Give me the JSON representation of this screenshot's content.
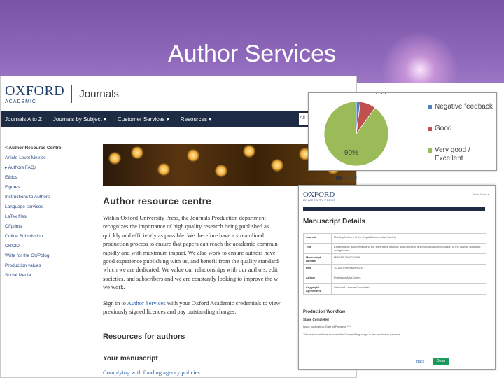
{
  "slide": {
    "title": "Author Services"
  },
  "oup": {
    "logo": {
      "oxford": "OXFORD",
      "academic": "ACADEMIC",
      "journals": "Journals"
    },
    "nav": [
      "Journals A to Z",
      "Journals by Subject ▾",
      "Customer Services ▾",
      "Resources ▾"
    ],
    "search_placeholder": "All",
    "sidebar": {
      "back": "< Author Resource Centre",
      "items": [
        "Article-Level Metrics",
        "Authors FAQs",
        "Ethics",
        "Figures",
        "Instructions to Authors",
        "Language services",
        "LaTex files",
        "Offprints",
        "Online Submission",
        "ORCID",
        "Write for the OUPblog",
        "Production values",
        "Social Media"
      ]
    },
    "page_title": "Author resource centre",
    "para_lines": [
      "Within Oxford University Press, the Journals Production department",
      "recognizes the importance of high quality research being published as",
      "quickly and efficiently as possible. We therefore have a streamlined",
      "production process to ensure that papers can reach the academic commun",
      "rapidly and with maximum impact. We also work to ensure authors have",
      "good experience publishing with us, and benefit from the quality standard",
      "which we are dedicated. We value our relationships with our authors, edit",
      "societies, and subscribers and we are constantly looking to improve the w",
      "we work."
    ],
    "signin": {
      "pre": "Sign in to ",
      "link": "Author Services",
      "post": " with your Oxford Academic credentials to view",
      "line2": "previously signed licences and pay outstanding charges."
    },
    "resources_heading": "Resources for authors",
    "manuscript_heading": "Your manuscript",
    "funding_link": "Complying with funding agency policies"
  },
  "chart_data": {
    "type": "pie",
    "categories": [
      "Negative feedback",
      "Good",
      "Very good / Excellent"
    ],
    "values": [
      2,
      8,
      90
    ],
    "data_labels": [
      "2%",
      "8%",
      "90%"
    ],
    "colors": [
      "#4f81bd",
      "#c0504d",
      "#9bbb59"
    ],
    "legend_position": "right"
  },
  "legend": [
    "Negative feedback",
    "Good",
    "Very good /\nExcellent"
  ],
  "youtube": "YouTu",
  "manuscript": {
    "logo": {
      "oxford": "OXFORD",
      "press": "UNIVERSITY PRESS"
    },
    "account": "Alice Jones ▾",
    "title": "Manuscript Details",
    "rows": [
      {
        "k": "Journal",
        "v": "Monthly Notices of the Royal Astronomical Society"
      },
      {
        "k": "Title",
        "v": "Extragalactic discoveries and the alternative galactic dust problem: a spectroscopic exploration of the cosmic dust light and galaxies"
      },
      {
        "k": "Manuscript Number",
        "v": "MNRAS-00000-2019"
      },
      {
        "k": "DOI",
        "v": "10.1093/mnras/stz0000"
      },
      {
        "k": "Author",
        "v": "Professor Alice Jones"
      },
      {
        "k": "Copyright Agreement",
        "v": "Standard Licence Completed"
      }
    ],
    "workflow_title": "Production Workflow",
    "workflow_sub": "Stage Completed",
    "workflow_line1": "Issue publication: Date of Progress ***",
    "workflow_line2": "This manuscript has reached the 'Copyediting' stage in the production process.",
    "back": "Back",
    "order": "Order"
  }
}
